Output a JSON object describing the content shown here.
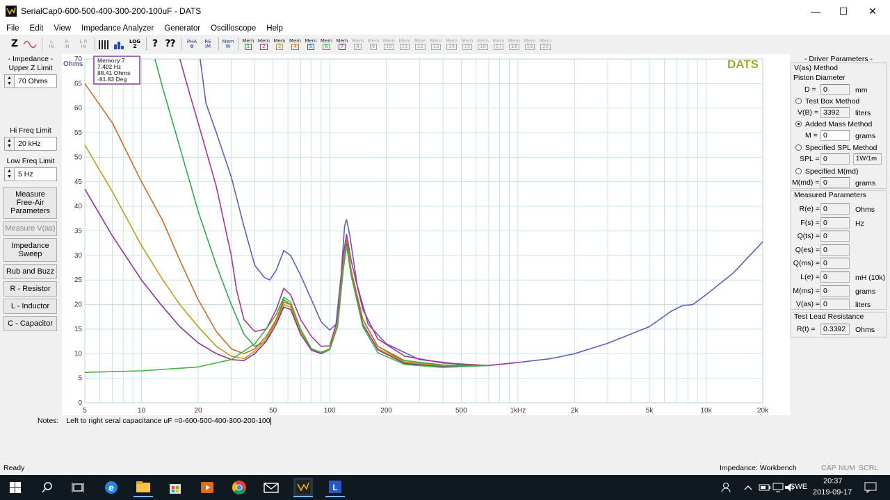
{
  "window": {
    "title": "SerialCap0-600-500-400-300-200-100uF - DATS",
    "minimize": "—",
    "maximize": "☐",
    "close": "✕"
  },
  "menu": [
    "File",
    "Edit",
    "View",
    "Impedance Analyzer",
    "Generator",
    "Oscilloscope",
    "Help"
  ],
  "toolbar": {
    "z_label": "Z",
    "l_in": "L\nIN",
    "r_in": "R\nIN",
    "l_r_in": "L R\nIN",
    "log_label": "LOG\nZ",
    "pha_label": "PHA\nΦ",
    "re_label": "RE\nIM",
    "mem_w": "Mem\nW",
    "mem_label": "Mem",
    "mem_numbers": [
      "1",
      "2",
      "3",
      "4",
      "5",
      "6",
      "7",
      "8",
      "9",
      "10",
      "11",
      "12",
      "13",
      "14",
      "15",
      "16",
      "17",
      "18",
      "19",
      "20"
    ],
    "mem_colors": [
      "#2e8b2e",
      "#b0309a",
      "#c09b0e",
      "#d2691e",
      "#3060b0",
      "#2eaa4a",
      "#9030a0"
    ]
  },
  "left": {
    "impedance_label": "- Impedance -",
    "upper_z_label": "Upper Z Limit",
    "upper_z_value": "70 Ohms",
    "hi_freq_label": "Hi Freq Limit",
    "hi_freq_value": "20 kHz",
    "low_freq_label": "Low Freq Limit",
    "low_freq_value": "5 Hz",
    "btn_free_air": "Measure\nFree-Air\nParameters",
    "btn_vas": "Measure V(as)",
    "btn_sweep": "Impedance\nSweep",
    "btn_rub": "Rub and Buzz",
    "btn_r": "R - Resistor",
    "btn_l": "L - Inductor",
    "btn_c": "C - Capacitor"
  },
  "chart_data": {
    "type": "line",
    "ylabel": "Ohms",
    "brand": "DATS",
    "ylim": [
      0,
      70
    ],
    "xlim": [
      5,
      20000
    ],
    "x_scale": "log",
    "y_ticks": [
      0,
      5,
      10,
      15,
      20,
      25,
      30,
      35,
      40,
      45,
      50,
      55,
      60,
      65,
      70
    ],
    "x_tick_values": [
      5,
      10,
      20,
      50,
      100,
      200,
      500,
      1000,
      2000,
      5000,
      10000,
      20000
    ],
    "x_tick_labels": [
      "5",
      "10",
      "20",
      "50",
      "100",
      "200",
      "500",
      "1kHz",
      "2k",
      "5k",
      "10k",
      "20k"
    ],
    "grid": true,
    "memory_box": {
      "title": "Memory 7",
      "freq": "7.402 Hz",
      "ohms": "88.41 Ohms",
      "deg": "-81.83 Deg",
      "color": "#9030a0"
    },
    "series": [
      {
        "color": "#5a5fc0",
        "points": [
          [
            20.5,
            70
          ],
          [
            22,
            61
          ],
          [
            25,
            55
          ],
          [
            30,
            46
          ],
          [
            35,
            36
          ],
          [
            40,
            28
          ],
          [
            45,
            25.5
          ],
          [
            48,
            25
          ],
          [
            52,
            27
          ],
          [
            57,
            31
          ],
          [
            62,
            30
          ],
          [
            70,
            26
          ],
          [
            80,
            21
          ],
          [
            90,
            16.5
          ],
          [
            100,
            14.8
          ],
          [
            108,
            16
          ],
          [
            115,
            26
          ],
          [
            120,
            36
          ],
          [
            123,
            37.3
          ],
          [
            128,
            34
          ],
          [
            140,
            24
          ],
          [
            160,
            16
          ],
          [
            200,
            12
          ],
          [
            300,
            8.8
          ],
          [
            500,
            7.8
          ],
          [
            700,
            7.6
          ],
          [
            1000,
            8.2
          ],
          [
            1500,
            9
          ],
          [
            2000,
            10
          ],
          [
            3000,
            12.1
          ],
          [
            5000,
            15.5
          ],
          [
            6500,
            18.6
          ],
          [
            7500,
            19.8
          ],
          [
            8500,
            20
          ],
          [
            10000,
            22
          ],
          [
            14000,
            26.5
          ],
          [
            20000,
            32.8
          ]
        ]
      },
      {
        "color": "#b0309a",
        "points": [
          [
            16,
            70
          ],
          [
            18,
            63
          ],
          [
            20,
            57
          ],
          [
            25,
            44
          ],
          [
            30,
            30
          ],
          [
            32,
            23
          ],
          [
            35,
            17
          ],
          [
            40,
            14.5
          ],
          [
            46,
            15
          ],
          [
            52,
            19
          ],
          [
            57,
            23.3
          ],
          [
            62,
            22
          ],
          [
            70,
            17
          ],
          [
            80,
            13.5
          ],
          [
            90,
            11.5
          ],
          [
            100,
            11.6
          ],
          [
            110,
            17
          ],
          [
            118,
            30
          ],
          [
            123,
            34.3
          ],
          [
            130,
            29
          ],
          [
            150,
            19
          ],
          [
            180,
            13
          ],
          [
            250,
            9.5
          ],
          [
            400,
            8.1
          ],
          [
            700,
            7.6
          ],
          [
            1000,
            8.2
          ]
        ]
      },
      {
        "color": "#2eaa4a",
        "points": [
          [
            11.8,
            70
          ],
          [
            13,
            64
          ],
          [
            16,
            52
          ],
          [
            20,
            39
          ],
          [
            25,
            28
          ],
          [
            30,
            20
          ],
          [
            35,
            14
          ],
          [
            40,
            11.5
          ],
          [
            46,
            12.5
          ],
          [
            52,
            17
          ],
          [
            57,
            21
          ],
          [
            62,
            20
          ],
          [
            70,
            14.5
          ],
          [
            80,
            11
          ],
          [
            90,
            10.3
          ],
          [
            100,
            11
          ],
          [
            110,
            16
          ],
          [
            118,
            28
          ],
          [
            123,
            33.3
          ],
          [
            130,
            27
          ],
          [
            150,
            17
          ],
          [
            180,
            11.5
          ],
          [
            250,
            8.6
          ],
          [
            400,
            7.7
          ],
          [
            700,
            7.6
          ]
        ]
      },
      {
        "color": "#d2691e",
        "points": [
          [
            5,
            65
          ],
          [
            7,
            57
          ],
          [
            10,
            45
          ],
          [
            13,
            37
          ],
          [
            16,
            29
          ],
          [
            20,
            21
          ],
          [
            25,
            14.5
          ],
          [
            30,
            11
          ],
          [
            35,
            10
          ],
          [
            40,
            11
          ],
          [
            46,
            13.5
          ],
          [
            52,
            17
          ],
          [
            57,
            20.5
          ],
          [
            62,
            20
          ],
          [
            70,
            15
          ],
          [
            80,
            11
          ],
          [
            90,
            10.2
          ],
          [
            100,
            11
          ],
          [
            110,
            16
          ],
          [
            118,
            28
          ],
          [
            123,
            33
          ],
          [
            130,
            27
          ],
          [
            150,
            17
          ],
          [
            180,
            11.5
          ],
          [
            250,
            8.3
          ],
          [
            400,
            7.5
          ],
          [
            700,
            7.6
          ]
        ]
      },
      {
        "color": "#c09b0e",
        "points": [
          [
            5,
            52.5
          ],
          [
            7,
            43
          ],
          [
            10,
            32
          ],
          [
            13,
            25
          ],
          [
            16,
            20
          ],
          [
            20,
            15.5
          ],
          [
            25,
            11.5
          ],
          [
            30,
            9.5
          ],
          [
            35,
            9
          ],
          [
            40,
            10.5
          ],
          [
            46,
            13
          ],
          [
            52,
            16.5
          ],
          [
            57,
            20
          ],
          [
            62,
            19.5
          ],
          [
            70,
            14.5
          ],
          [
            80,
            11
          ],
          [
            90,
            10.2
          ],
          [
            100,
            11
          ],
          [
            110,
            16
          ],
          [
            118,
            28
          ],
          [
            123,
            32.6
          ],
          [
            130,
            26
          ],
          [
            150,
            16
          ],
          [
            180,
            11
          ],
          [
            250,
            8.2
          ],
          [
            400,
            7.4
          ],
          [
            700,
            7.6
          ]
        ]
      },
      {
        "color": "#9030a0",
        "points": [
          [
            5,
            43.5
          ],
          [
            7,
            34
          ],
          [
            10,
            25
          ],
          [
            13,
            19.5
          ],
          [
            16,
            15.5
          ],
          [
            20,
            12.2
          ],
          [
            25,
            10
          ],
          [
            30,
            8.8
          ],
          [
            35,
            8.6
          ],
          [
            40,
            10
          ],
          [
            46,
            12.5
          ],
          [
            52,
            16
          ],
          [
            57,
            19.5
          ],
          [
            62,
            19
          ],
          [
            70,
            14
          ],
          [
            80,
            10.7
          ],
          [
            90,
            10
          ],
          [
            100,
            10.8
          ],
          [
            110,
            15.5
          ],
          [
            118,
            27
          ],
          [
            123,
            32.3
          ],
          [
            130,
            26
          ],
          [
            150,
            16
          ],
          [
            180,
            10.8
          ],
          [
            250,
            8
          ],
          [
            400,
            7.3
          ],
          [
            700,
            7.6
          ]
        ]
      },
      {
        "color": "#3fb53f",
        "points": [
          [
            5,
            6.2
          ],
          [
            10,
            6.5
          ],
          [
            20,
            7.3
          ],
          [
            30,
            8.8
          ],
          [
            40,
            12
          ],
          [
            46,
            15
          ],
          [
            52,
            18
          ],
          [
            57,
            21.5
          ],
          [
            62,
            20.5
          ],
          [
            70,
            15
          ],
          [
            80,
            11
          ],
          [
            90,
            10.2
          ],
          [
            100,
            10.8
          ],
          [
            110,
            15.5
          ],
          [
            118,
            27
          ],
          [
            123,
            32
          ],
          [
            130,
            26
          ],
          [
            150,
            15.5
          ],
          [
            180,
            10.2
          ],
          [
            250,
            7.8
          ],
          [
            400,
            7.2
          ],
          [
            700,
            7.6
          ]
        ]
      }
    ]
  },
  "notes": {
    "label": "Notes:",
    "text": "Left to right seral capacitance uF =0-600-500-400-300-200-100"
  },
  "right": {
    "driver_params": "- Driver Parameters -",
    "vas_method": "V(as) Method",
    "piston_diameter": "Piston Diameter",
    "d_label": "D =",
    "d_value": "0",
    "d_unit": "mm",
    "test_box": "Test Box Method",
    "vb_label": "V(B) =",
    "vb_value": "3392",
    "vb_unit": "liters",
    "added_mass": "Added Mass Method",
    "m_label": "M =",
    "m_value": "0",
    "m_unit": "grams",
    "spl_method": "Specified SPL Method",
    "spl_label": "SPL =",
    "spl_value": "0",
    "spl_unit": "1W/1m",
    "mmd_method": "Specified M(md)",
    "mmd_label": "M(md) =",
    "mmd_value": "0",
    "mmd_unit": "grams",
    "measured_params": "Measured Parameters",
    "measured": [
      {
        "label": "R(e) =",
        "value": "0",
        "unit": "Ohms"
      },
      {
        "label": "F(s) =",
        "value": "0",
        "unit": "Hz"
      },
      {
        "label": "Q(ts) =",
        "value": "0",
        "unit": ""
      },
      {
        "label": "Q(es) =",
        "value": "0",
        "unit": ""
      },
      {
        "label": "Q(ms) =",
        "value": "0",
        "unit": ""
      },
      {
        "label": "L(e) =",
        "value": "0",
        "unit": "mH (10k)"
      },
      {
        "label": "M(ms) =",
        "value": "0",
        "unit": "grams"
      },
      {
        "label": "V(as) =",
        "value": "0",
        "unit": "liters"
      }
    ],
    "test_lead": "Test Lead Resistance",
    "rt_label": "R(t) =",
    "rt_value": "0.3392",
    "rt_unit": "Ohms"
  },
  "status": {
    "ready": "Ready",
    "mode": "Impedance: Workbench",
    "cap": "CAP",
    "num": "NUM",
    "scrl": "SCRL"
  },
  "taskbar": {
    "lang": "SWE",
    "time": "20:37",
    "date": "2019-09-17"
  }
}
